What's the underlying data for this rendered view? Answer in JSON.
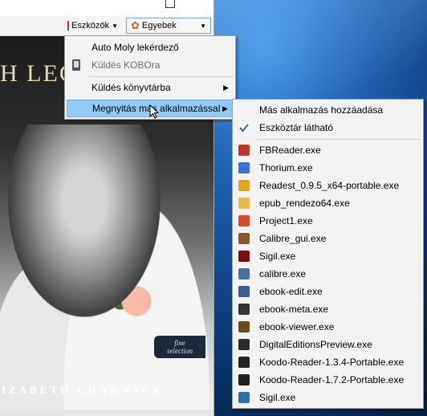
{
  "toolbar": {
    "eszkozok_label": "Eszközök",
    "egyebek_label": "Egyebek"
  },
  "cover": {
    "title_fragment": "H LEG",
    "author_fragment": "IZABETH CHADWICK",
    "badge_line1": "fine",
    "badge_line2": "selection"
  },
  "menu_primary": {
    "items": [
      {
        "label": "Auto Moly lekérdező",
        "icon": "blank",
        "enabled": true
      },
      {
        "label": "Küldés KOBOra",
        "icon": "ereader-icon",
        "enabled": false
      },
      {
        "label": "Küldés könyvtárba",
        "icon": "blank",
        "enabled": true,
        "submenu": true
      },
      {
        "label": "Megnyitás más alkalmazással",
        "icon": "blank",
        "enabled": true,
        "submenu": true,
        "highlighted": true
      }
    ]
  },
  "menu_open_with": {
    "top_items": [
      {
        "label": "Más alkalmazás hozzáadása",
        "checked": false
      },
      {
        "label": "Eszköztár látható",
        "checked": true
      }
    ],
    "apps": [
      {
        "label": "FBReader.exe",
        "icon": "fbreader-icon",
        "color": "#c0392b"
      },
      {
        "label": "Thorium.exe",
        "icon": "thorium-icon",
        "color": "#3a6fd8"
      },
      {
        "label": "Readest_0.9.5_x64-portable.exe",
        "icon": "readest-icon",
        "color": "#e0a326"
      },
      {
        "label": "epub_rendezo64.exe",
        "icon": "folder-icon",
        "color": "#e8b84a"
      },
      {
        "label": "Project1.exe",
        "icon": "project-icon",
        "color": "#d94b2a"
      },
      {
        "label": "Calibre_gui.exe",
        "icon": "calibre-icon",
        "color": "#8a5a2b"
      },
      {
        "label": "Sigil.exe",
        "icon": "sigil-icon",
        "color": "#7a1010"
      },
      {
        "label": "calibre.exe",
        "icon": "calibre-books-icon",
        "color": "#4a6fa5"
      },
      {
        "label": "ebook-edit.exe",
        "icon": "ebook-edit-icon",
        "color": "#3b5d8f"
      },
      {
        "label": "ebook-meta.exe",
        "icon": "ebook-meta-icon",
        "color": "#333333"
      },
      {
        "label": "ebook-viewer.exe",
        "icon": "ebook-viewer-icon",
        "color": "#6b4a1e"
      },
      {
        "label": "DigitalEditionsPreview.exe",
        "icon": "adobe-de-icon",
        "color": "#2b2b2b"
      },
      {
        "label": "Koodo-Reader-1.3.4-Portable.exe",
        "icon": "koodo-icon",
        "color": "#222222"
      },
      {
        "label": "Koodo-Reader-1.7.2-Portable.exe",
        "icon": "koodo-icon",
        "color": "#222222"
      },
      {
        "label": "Sigil.exe",
        "icon": "sigil-blue-icon",
        "color": "#2d6fa8"
      }
    ]
  },
  "colors": {
    "highlight": "#91c9f7",
    "menu_bg": "#f2f2f2",
    "checkmark": "#2b6cb0"
  }
}
